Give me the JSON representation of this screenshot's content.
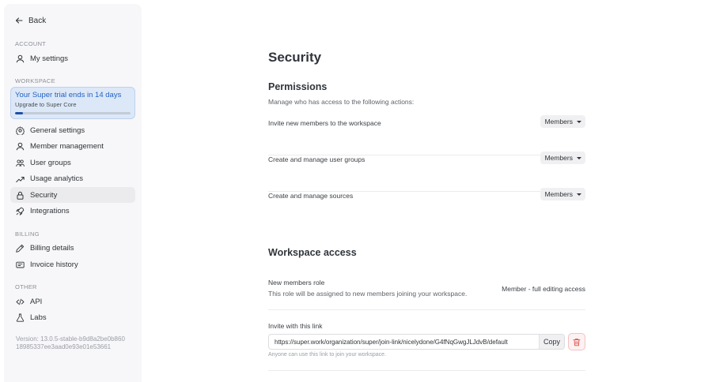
{
  "sidebar": {
    "back_label": "Back",
    "sections": {
      "account": "ACCOUNT",
      "workspace": "WORKSPACE",
      "billing": "BILLING",
      "other": "OTHER"
    },
    "account_items": [
      {
        "label": "My settings",
        "icon": "user-icon"
      }
    ],
    "trial": {
      "title": "Your Super trial ends in 14 days",
      "subtitle": "Upgrade to Super Core",
      "progress_percent": 7
    },
    "workspace_items": [
      {
        "label": "General settings",
        "icon": "gear-icon"
      },
      {
        "label": "Member management",
        "icon": "user-icon"
      },
      {
        "label": "User groups",
        "icon": "users-icon"
      },
      {
        "label": "Usage analytics",
        "icon": "trend-icon"
      },
      {
        "label": "Security",
        "icon": "lock-icon",
        "active": true
      },
      {
        "label": "Integrations",
        "icon": "rocket-icon"
      }
    ],
    "billing_items": [
      {
        "label": "Billing details",
        "icon": "pen-icon"
      },
      {
        "label": "Invoice history",
        "icon": "receipt-icon"
      }
    ],
    "other_items": [
      {
        "label": "API",
        "icon": "code-icon"
      },
      {
        "label": "Labs",
        "icon": "flask-icon"
      }
    ],
    "version_line1": "Version: 13.0.5-stable-b9d8a2be0b860",
    "version_line2": "18985337ee3aad0e93e01e53661"
  },
  "main": {
    "title": "Security",
    "permissions": {
      "heading": "Permissions",
      "description": "Manage who has access to the following actions:",
      "rows": [
        {
          "label": "Invite new members to the workspace",
          "value": "Members"
        },
        {
          "label": "Create and manage user groups",
          "value": "Members"
        },
        {
          "label": "Create and manage sources",
          "value": "Members"
        }
      ]
    },
    "workspace_access": {
      "heading": "Workspace access",
      "new_members_role_label": "New members role",
      "new_members_role_desc": "This role will be assigned to new members joining your workspace.",
      "new_members_role_value": "Member - full editing access",
      "invite_label": "Invite with this link",
      "invite_url": "https://super.work/organization/super/join-link/nicelydone/G4fNqGwgJLJdvB/default",
      "copy_label": "Copy",
      "invite_hint": "Anyone can use this link to join your workspace."
    }
  },
  "colors": {
    "accent": "#2462c4",
    "trial_bg": "#dce8f7",
    "danger": "#d9534f"
  }
}
